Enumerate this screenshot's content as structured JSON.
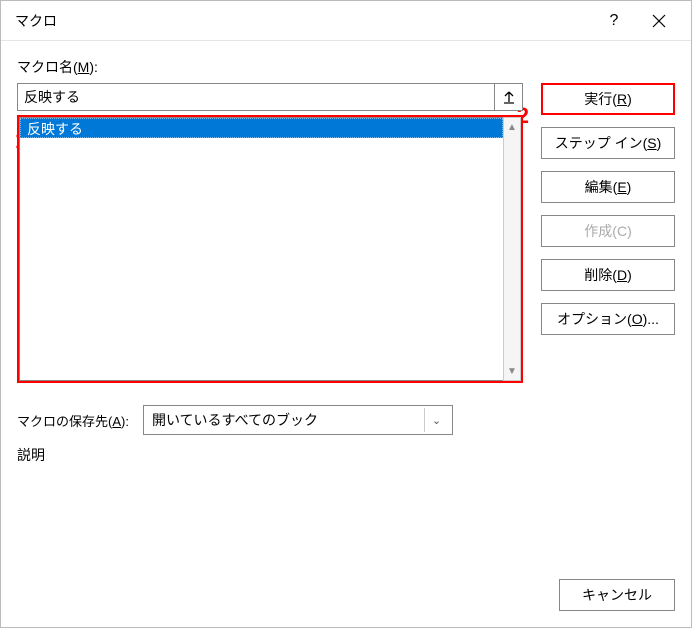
{
  "dialog": {
    "title": "マクロ"
  },
  "labels": {
    "macro_name": "マクロ名(",
    "macro_name_hotkey": "M",
    "macro_name_suffix": "):",
    "save_location": "マクロの保存先(",
    "save_location_hotkey": "A",
    "save_location_suffix": "):",
    "description": "説明"
  },
  "fields": {
    "macro_name_value": "反映する",
    "save_location_value": "開いているすべてのブック"
  },
  "list": {
    "items": [
      "反映する"
    ]
  },
  "buttons": {
    "run": "実行(",
    "run_hotkey": "R",
    "run_suffix": ")",
    "step_in": "ステップ イン(",
    "step_in_hotkey": "S",
    "step_in_suffix": ")",
    "edit": "編集(",
    "edit_hotkey": "E",
    "edit_suffix": ")",
    "create": "作成(",
    "create_hotkey": "C",
    "create_suffix": ")",
    "delete": "削除(",
    "delete_hotkey": "D",
    "delete_suffix": ")",
    "options": "オプション(",
    "options_hotkey": "O",
    "options_suffix": ")...",
    "cancel": "キャンセル"
  },
  "markers": {
    "one": "1",
    "two": "2"
  }
}
